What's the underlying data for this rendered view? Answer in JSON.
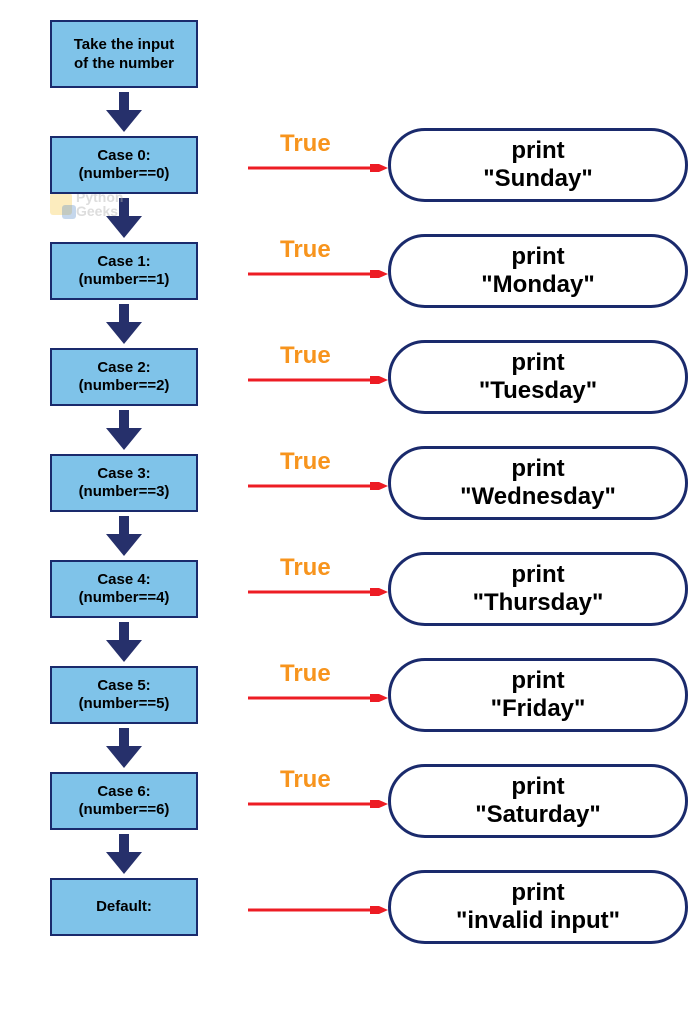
{
  "input_box": {
    "line1": "Take the input",
    "line2": "of the number"
  },
  "cases": [
    {
      "label": "Case 0:",
      "cond": "(number==0)",
      "true": "True",
      "out1": "print",
      "out2": "\"Sunday\""
    },
    {
      "label": "Case 1:",
      "cond": "(number==1)",
      "true": "True",
      "out1": "print",
      "out2": "\"Monday\""
    },
    {
      "label": "Case 2:",
      "cond": "(number==2)",
      "true": "True",
      "out1": "print",
      "out2": "\"Tuesday\""
    },
    {
      "label": "Case 3:",
      "cond": "(number==3)",
      "true": "True",
      "out1": "print",
      "out2": "\"Wednesday\""
    },
    {
      "label": "Case 4:",
      "cond": "(number==4)",
      "true": "True",
      "out1": "print",
      "out2": "\"Thursday\""
    },
    {
      "label": "Case 5:",
      "cond": "(number==5)",
      "true": "True",
      "out1": "print",
      "out2": "\"Friday\""
    },
    {
      "label": "Case 6:",
      "cond": "(number==6)",
      "true": "True",
      "out1": "print",
      "out2": "\"Saturday\""
    }
  ],
  "default_case": {
    "label": "Default:",
    "out1": "print",
    "out2": "\"invalid input\""
  },
  "watermark": {
    "line1": "Python",
    "line2": "Geeks"
  },
  "colors": {
    "box_fill": "#7fc3e9",
    "box_border": "#1a2a6c",
    "arrow_down": "#26306b",
    "arrow_red": "#ed1c24",
    "true_label": "#f7941d"
  }
}
